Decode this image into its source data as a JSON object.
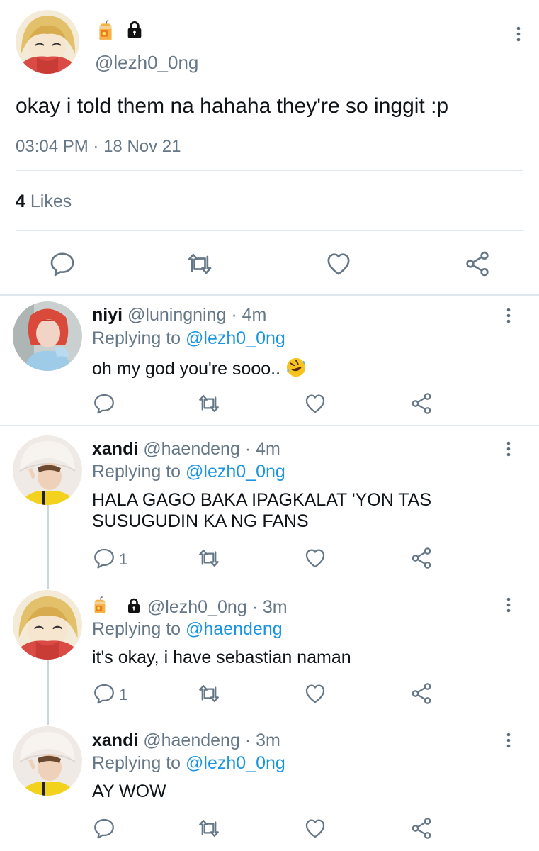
{
  "main_tweet": {
    "handle": "@lezh0_0ng",
    "name_icons": [
      "juice-box-emoji",
      "lock-icon"
    ],
    "text": "okay i told them na hahaha they're so inggit :p",
    "time": "03:04 PM",
    "separator": "·",
    "date": "18 Nov 21",
    "likes_count": "4",
    "likes_label": "Likes",
    "actions": [
      "reply-icon",
      "retweet-icon",
      "like-icon",
      "share-icon"
    ]
  },
  "replies": [
    {
      "name": "niyi",
      "handle": "@luningning",
      "sep": "·",
      "time": "4m",
      "replying_prefix": "Replying to",
      "replying_to": "@lezh0_0ng",
      "text": "oh my god you're sooo..",
      "emoji": "rolling-on-floor-laughing-emoji",
      "reply_count": ""
    },
    {
      "name": "xandi",
      "handle": "@haendeng",
      "sep": "·",
      "time": "4m",
      "replying_prefix": "Replying to",
      "replying_to": "@lezh0_0ng",
      "text_line1": "HALA GAGO BAKA IPAGKALAT 'YON TAS",
      "text_line2": "SUSUGUDIN KA NG FANS",
      "reply_count": "1"
    },
    {
      "name": "",
      "handle": "@lezh0_0ng",
      "sep": "·",
      "time": "3m",
      "replying_prefix": "Replying to",
      "replying_to": "@haendeng",
      "text": "it's okay, i have sebastian naman",
      "reply_count": "1"
    },
    {
      "name": "xandi",
      "handle": "@haendeng",
      "sep": "·",
      "time": "3m",
      "replying_prefix": "Replying to",
      "replying_to": "@lezh0_0ng",
      "text": "AY WOW",
      "reply_count": ""
    }
  ],
  "colors": {
    "text_primary": "#0f1419",
    "text_secondary": "#657786",
    "link": "#1b95e0",
    "divider": "#e1e8ed",
    "thread_line": "#ccd6dd"
  }
}
